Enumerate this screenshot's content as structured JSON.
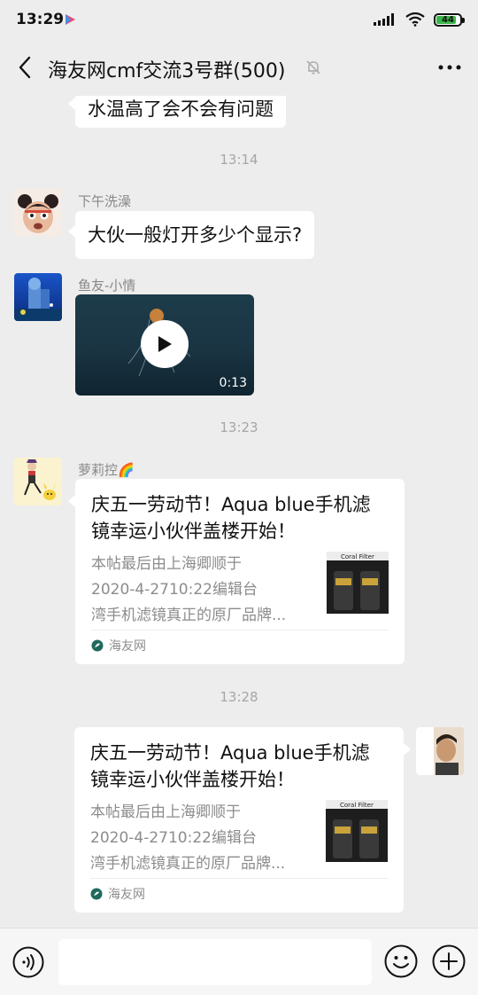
{
  "status": {
    "time": "13:29",
    "battery": "44"
  },
  "header": {
    "back_icon": "chevron-left-icon",
    "title": "海友网cmf交流3号群(500)",
    "mute_icon": "bell-off-icon",
    "more_icon": "more-dots-icon"
  },
  "messages": {
    "partial_text": "水温高了会不会有问题",
    "ts1": "13:14",
    "m1": {
      "sender": "下午洗澡",
      "text": "大伙一般灯开多少个显示?"
    },
    "m2": {
      "sender": "鱼友-小情",
      "video_duration": "0:13"
    },
    "ts2": "13:23",
    "m3": {
      "sender": "萝莉控🌈",
      "card_title": "庆五一劳动节！Aqua blue手机滤镜幸运小伙伴盖楼开始！",
      "card_desc": [
        "本帖最后由上海卿顺于",
        "2020-4-2710:22编辑台",
        "湾手机滤镜真正的原厂品牌..."
      ],
      "thumb_label": "Coral Filter",
      "source": "海友网"
    },
    "ts3": "13:28",
    "m4": {
      "card_title": "庆五一劳动节！Aqua blue手机滤镜幸运小伙伴盖楼开始！",
      "card_desc": [
        "本帖最后由上海卿顺于",
        "2020-4-2710:22编辑台",
        "湾手机滤镜真正的原厂品牌..."
      ],
      "thumb_label": "Coral Filter",
      "source": "海友网"
    }
  },
  "input": {
    "placeholder": "",
    "voice_icon": "voice-icon",
    "emoji_icon": "emoji-icon",
    "plus_icon": "plus-circle-icon"
  },
  "colors": {
    "background": "#ededed",
    "bubble": "#ffffff",
    "timestamp": "#a6a6a6",
    "battery": "#3bb54a"
  }
}
